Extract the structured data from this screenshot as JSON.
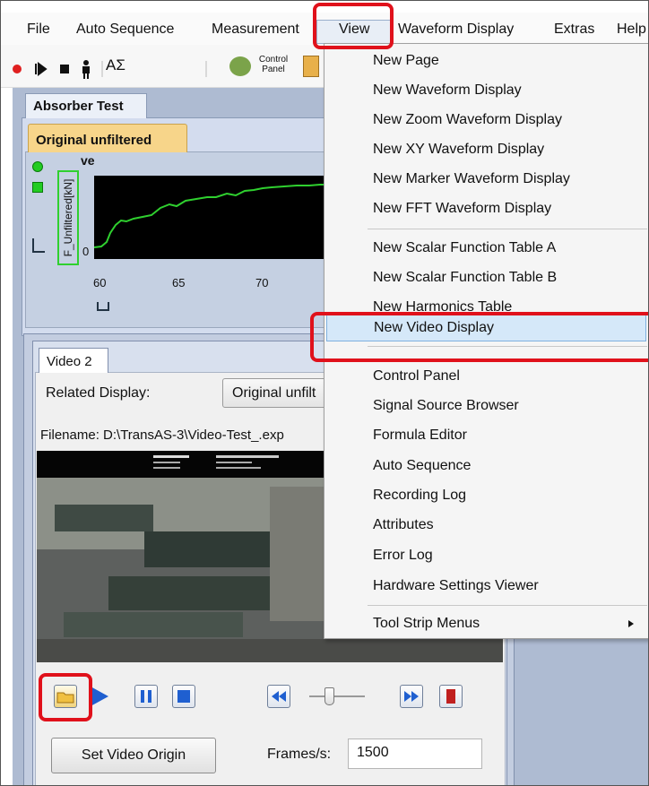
{
  "menubar": {
    "items": [
      "File",
      "Auto Sequence",
      "Measurement",
      "View",
      "Waveform Display",
      "Extras",
      "Help"
    ]
  },
  "toolbar": {
    "control_panel_label": "Control Panel",
    "sigma_label": "AΣ"
  },
  "page_tab": "Absorber Test",
  "waveform": {
    "tab_label": "Original unfiltered",
    "y_axis_label": "F_Unfiltered[kN]",
    "y_axis_top_label": "ve",
    "y_zero_label": "0",
    "x_ticks": [
      "60",
      "65",
      "70"
    ]
  },
  "video": {
    "tab_label": "Video 2",
    "related_label": "Related Display:",
    "related_value": "Original unfilt",
    "filename": "Filename: D:\\TransAS-3\\Video-Test_.exp",
    "set_origin_label": "Set Video Origin",
    "fps_label": "Frames/s:",
    "fps_value": "1500"
  },
  "view_menu": {
    "items": [
      "New Page",
      "New Waveform Display",
      "New Zoom Waveform Display",
      "New XY Waveform Display",
      "New Marker Waveform Display",
      "New FFT Waveform Display",
      "New Scalar Function Table A",
      "New Scalar Function Table B",
      "New Harmonics Table",
      "New Video Display",
      "Control Panel",
      "Signal Source Browser",
      "Formula Editor",
      "Auto Sequence",
      "Recording Log",
      "Attributes",
      "Error Log",
      "Hardware Settings Viewer",
      "Tool Strip Menus"
    ],
    "highlighted": "New Video Display"
  },
  "colors": {
    "highlight": "#e0111b",
    "selection": "#d5e8f9",
    "trace": "#2fd02f",
    "tab_orange": "#f7d58a"
  }
}
